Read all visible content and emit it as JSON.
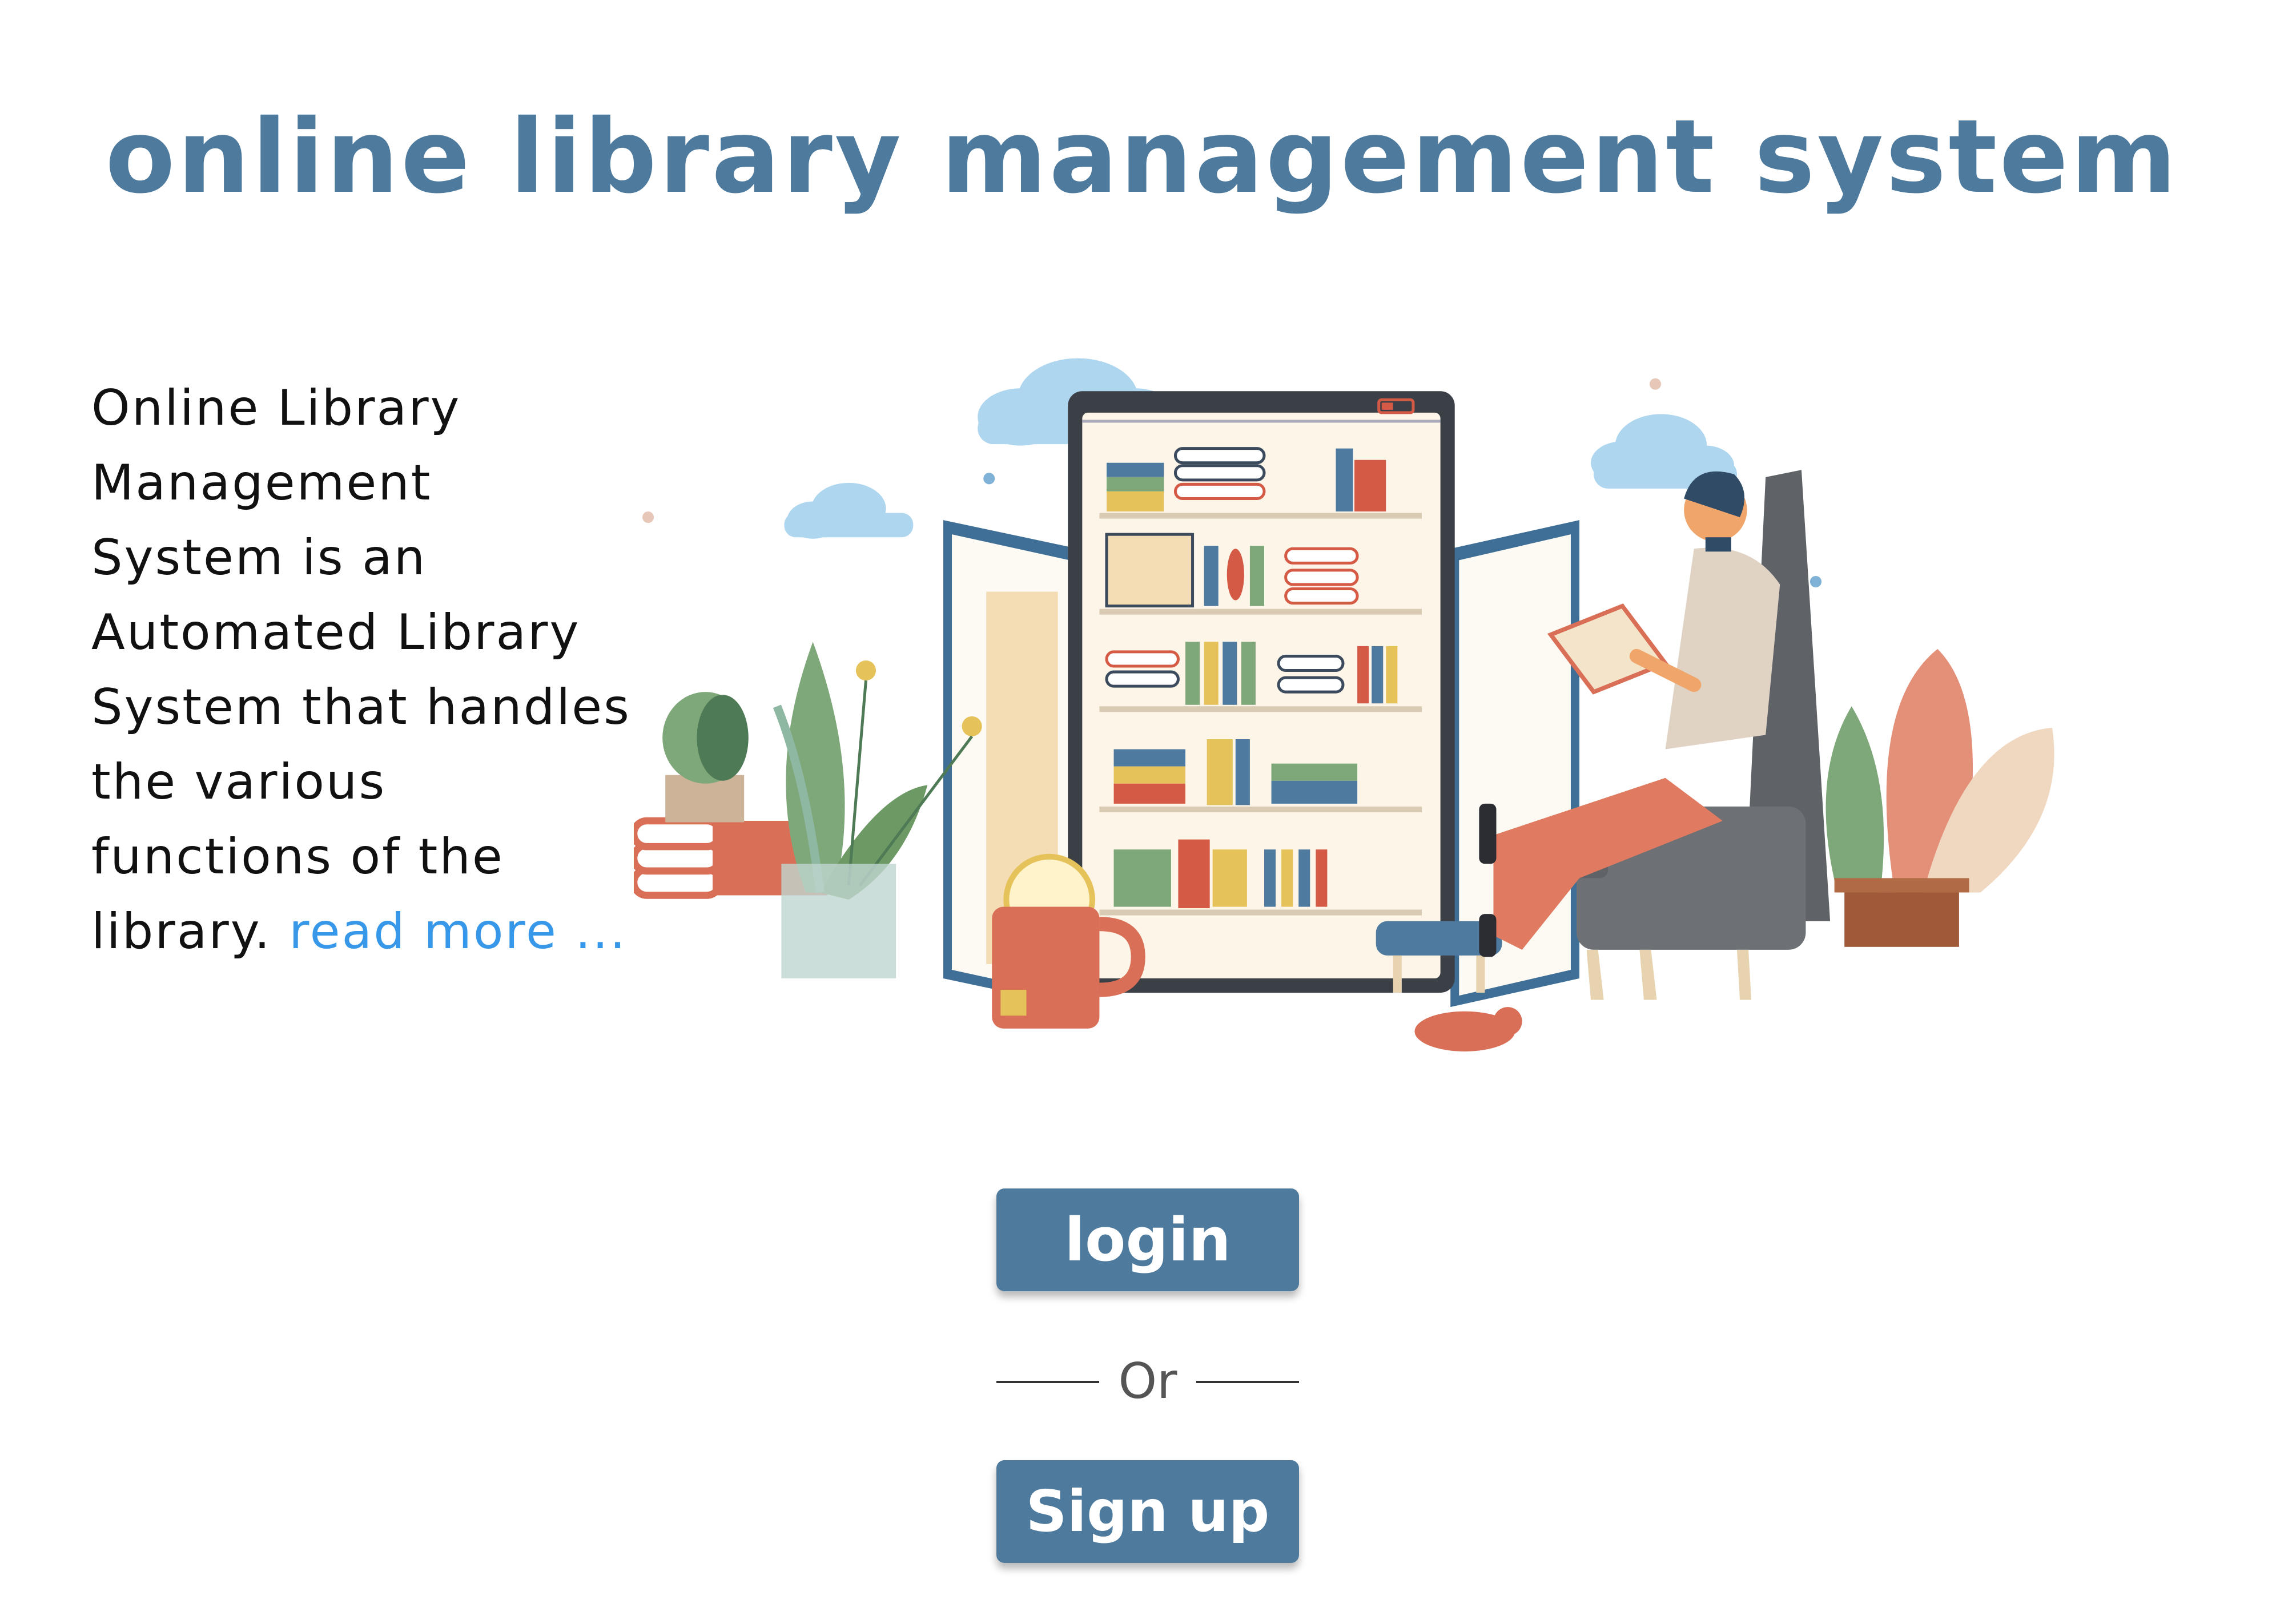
{
  "header": {
    "title": "online library management system"
  },
  "intro": {
    "text": "Online Library Management System is an Automated Library System that handles the various functions of the library. ",
    "read_more_label": "read more ..."
  },
  "illustration": {
    "icon": "library-reading-illustration"
  },
  "auth": {
    "login_label": "login",
    "divider_label": "Or",
    "signup_label": "Sign up"
  },
  "colors": {
    "accent": "#4d7a9d",
    "link": "#3797e8",
    "background": "#ffffff"
  }
}
